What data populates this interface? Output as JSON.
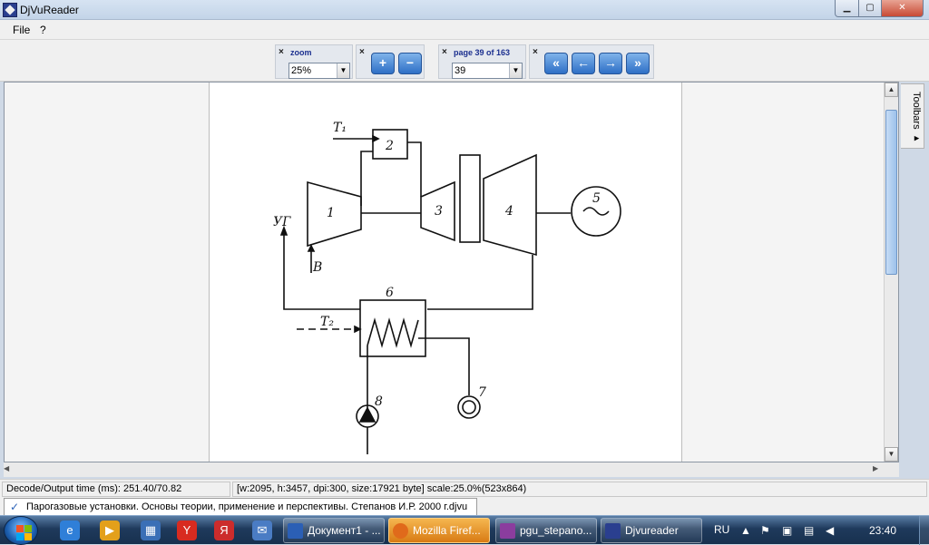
{
  "window": {
    "title": "DjVuReader",
    "min": "▁",
    "max": "▢",
    "close": "✕"
  },
  "menu": {
    "file": "File",
    "help": "?"
  },
  "toolbar": {
    "zoom_label": "zoom",
    "zoom_value": "25%",
    "zoom_in": "+",
    "zoom_out": "−",
    "page_label": "page 39 of 163",
    "page_value": "39",
    "first": "«",
    "prev": "←",
    "next": "→",
    "last": "»",
    "close_glyph": "×"
  },
  "side_tab": {
    "label": "Toolbars ▸"
  },
  "diagram": {
    "labels": {
      "t1": "T₁",
      "box2": "2",
      "box1": "1",
      "box3": "3",
      "box4": "4",
      "circle5": "5",
      "box6": "6",
      "ug": "УГ",
      "v": "В",
      "t2": "T₂",
      "circle7": "7",
      "pump8": "8"
    }
  },
  "status": {
    "decode": "Decode/Output time (ms): 251.40/70.82",
    "info": "[w:2095, h:3457, dpi:300, size:17921 byte] scale:25.0%(523x864)"
  },
  "file_tab": {
    "check": "✓",
    "name": "Парогазовые установки. Основы теории, применение и перспективы. Степанов И.Р. 2000 г.djvu"
  },
  "taskbar": {
    "items": [
      {
        "label": "Документ1 - ...",
        "icon_color": "#2b5fb5"
      },
      {
        "label": "Mozilla Firef...",
        "icon_color": "#e06a1b"
      },
      {
        "label": "pgu_stepano...",
        "icon_color": "#8b3d9e"
      },
      {
        "label": "Djvureader",
        "icon_color": "#2a3f8f"
      }
    ],
    "lang": "RU",
    "clock": "23:40"
  }
}
